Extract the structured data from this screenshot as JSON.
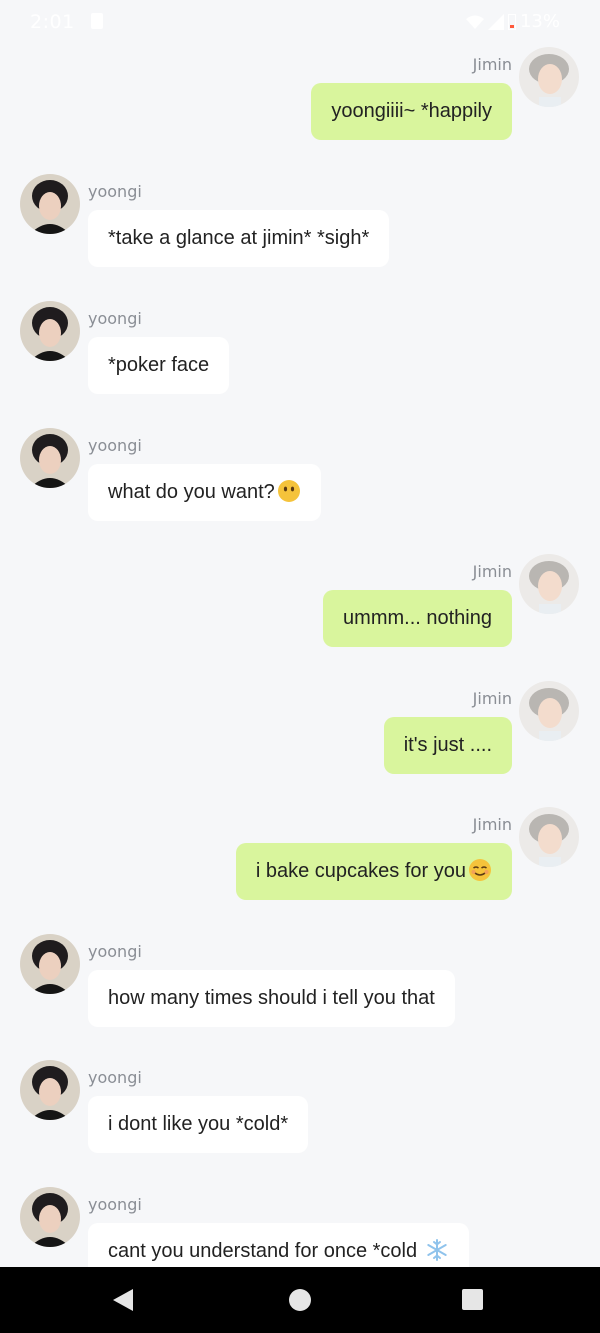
{
  "status_bar": {
    "time": "2:01",
    "battery": "13%"
  },
  "messages": [
    {
      "sender": "Jimin",
      "side": "right",
      "text": "yoongiiii~ *happily",
      "emoji": ""
    },
    {
      "sender": "yoongi",
      "side": "left",
      "text": "*take a glance at jimin* *sigh*",
      "emoji": ""
    },
    {
      "sender": "yoongi",
      "side": "left",
      "text": "*poker face",
      "emoji": ""
    },
    {
      "sender": "yoongi",
      "side": "left",
      "text": "what do you want?",
      "emoji": "no-mouth-face"
    },
    {
      "sender": "Jimin",
      "side": "right",
      "text": "ummm... nothing",
      "emoji": ""
    },
    {
      "sender": "Jimin",
      "side": "right",
      "text": "it's just ....",
      "emoji": ""
    },
    {
      "sender": "Jimin",
      "side": "right",
      "text": "i bake cupcakes for you",
      "emoji": "relieved-face"
    },
    {
      "sender": "yoongi",
      "side": "left",
      "text": "how many times should i tell you that",
      "emoji": ""
    },
    {
      "sender": "yoongi",
      "side": "left",
      "text": "i dont like you *cold*",
      "emoji": ""
    },
    {
      "sender": "yoongi",
      "side": "left",
      "text": "cant you understand for once *cold ",
      "emoji": "snowflake"
    }
  ],
  "colors": {
    "background": "#f6f7f9",
    "outgoing_bubble": "#d9f59d",
    "incoming_bubble": "#ffffff",
    "name_text": "#8a8e95"
  },
  "navbar": {
    "icons": [
      "back-icon",
      "home-icon",
      "recents-icon"
    ]
  }
}
